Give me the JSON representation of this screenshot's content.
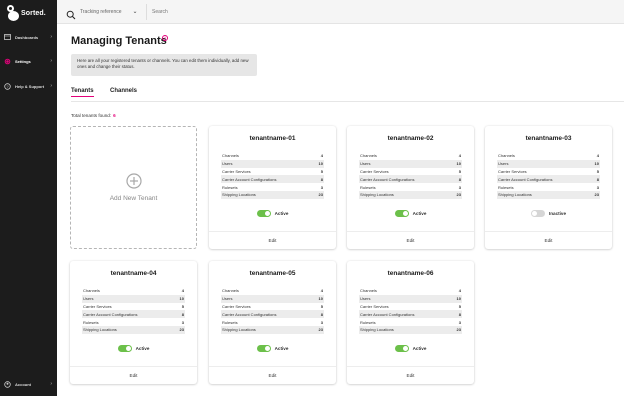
{
  "brand": {
    "name": "Sorted.",
    "accent": "#e3007a"
  },
  "sidebar": {
    "items": [
      {
        "label": "Dashboards",
        "icon": "dashboard-icon"
      },
      {
        "label": "Settings",
        "icon": "gear-icon",
        "active": true
      },
      {
        "label": "Help & Support",
        "icon": "help-icon"
      },
      {
        "label": "Account",
        "icon": "account-icon"
      }
    ]
  },
  "topbar": {
    "tracking_label": "Tracking reference",
    "search_placeholder": "Search"
  },
  "page": {
    "title": "Managing Tenants",
    "info": "Here are all your registered tenants or channels. You can edit them individually, add new ones and change their status.",
    "tabs": [
      "Tenants",
      "Channels"
    ],
    "total_label": "Total tenants found:",
    "total_count": "6",
    "add_label": "Add New Tenant",
    "edit_label": "Edit"
  },
  "stat_labels": [
    "Channels",
    "Users",
    "Carrier Services",
    "Carrier Account Configurations",
    "Rulesets",
    "Shipping Locations"
  ],
  "tenants": [
    {
      "name": "tenantname-01",
      "stats": [
        "4",
        "10",
        "5",
        "8",
        "3",
        "23"
      ],
      "status": "Active",
      "on": true
    },
    {
      "name": "tenantname-02",
      "stats": [
        "4",
        "10",
        "5",
        "8",
        "3",
        "23"
      ],
      "status": "Active",
      "on": true
    },
    {
      "name": "tenantname-03",
      "stats": [
        "4",
        "10",
        "5",
        "8",
        "3",
        "23"
      ],
      "status": "Inactive",
      "on": false
    },
    {
      "name": "tenantname-04",
      "stats": [
        "4",
        "10",
        "5",
        "8",
        "3",
        "23"
      ],
      "status": "Active",
      "on": true
    },
    {
      "name": "tenantname-05",
      "stats": [
        "4",
        "10",
        "5",
        "8",
        "3",
        "23"
      ],
      "status": "Active",
      "on": true
    },
    {
      "name": "tenantname-06",
      "stats": [
        "4",
        "10",
        "5",
        "8",
        "3",
        "23"
      ],
      "status": "Active",
      "on": true
    }
  ]
}
